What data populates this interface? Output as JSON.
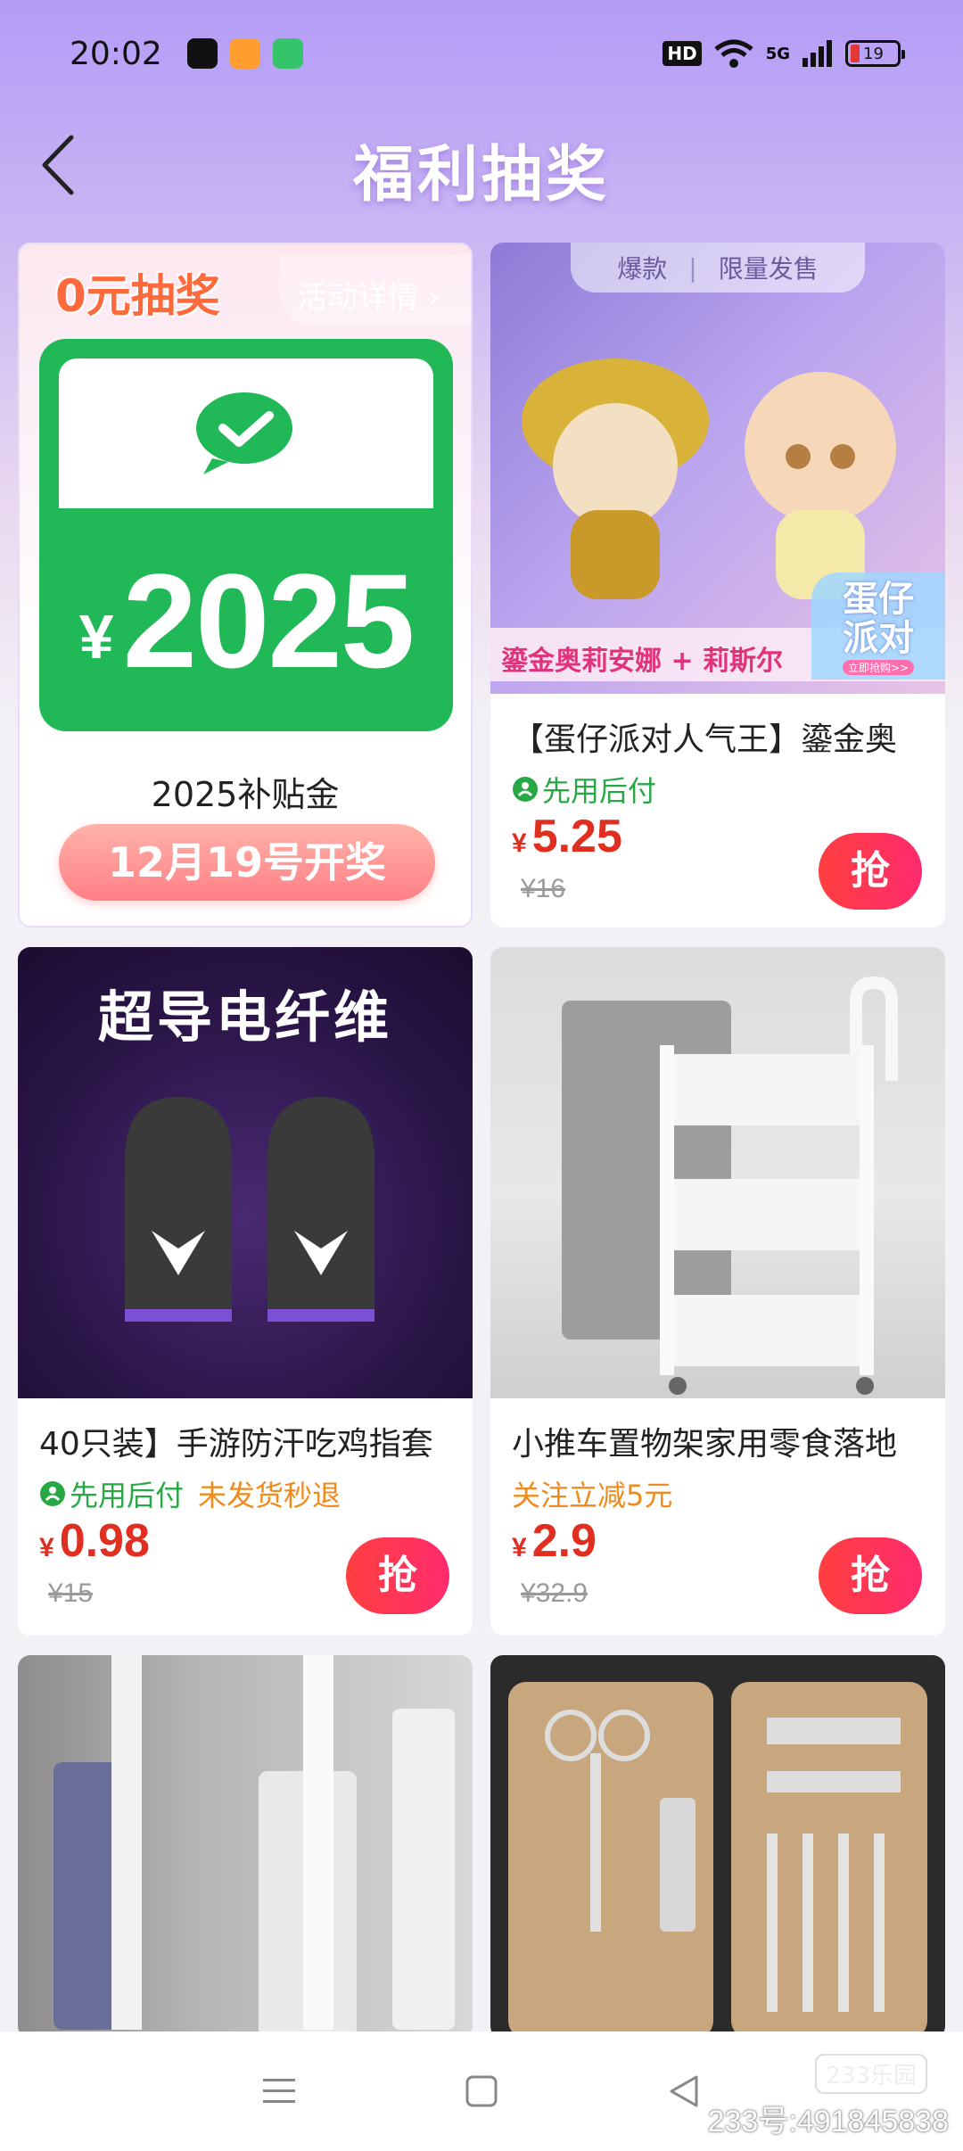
{
  "status_bar": {
    "time": "20:02",
    "hd": "HD",
    "network": "5G",
    "battery": "19"
  },
  "header": {
    "title": "福利抽奖"
  },
  "lottery": {
    "tag": "0元抽奖",
    "detail_link": "活动详情 ›",
    "currency": "¥",
    "amount": "2025",
    "prize_name": "2025补贴金",
    "draw_date": "12月19号开奖"
  },
  "products": [
    {
      "image_badges": [
        "爆款",
        "限量发售"
      ],
      "image_caption": "鎏金奥莉安娜 + 莉斯尔",
      "image_brand": "蛋仔派对",
      "image_brand_sub": "立即抢购>>",
      "title": "【蛋仔派对人气王】鎏金奥",
      "tags": [
        "先用后付"
      ],
      "currency": "¥",
      "price": "5.25",
      "original_price": "¥16",
      "button": "抢"
    },
    {
      "image_banner": "超导电纤维",
      "title": "40只装】手游防汗吃鸡指套",
      "tags": [
        "先用后付",
        "未发货秒退"
      ],
      "currency": "¥",
      "price": "0.98",
      "original_price": "¥15",
      "button": "抢"
    },
    {
      "title": "小推车置物架家用零食落地",
      "tags": [
        "关注立减5元"
      ],
      "currency": "¥",
      "price": "2.9",
      "original_price": "¥32.9",
      "button": "抢"
    },
    {
      "title": ""
    },
    {
      "title": ""
    }
  ],
  "watermark": {
    "logo": "233乐园",
    "id": "233号:491845838"
  },
  "colors": {
    "accent_red": "#e02f21",
    "wechat_green": "#21b857",
    "pay_green": "#27a844"
  }
}
